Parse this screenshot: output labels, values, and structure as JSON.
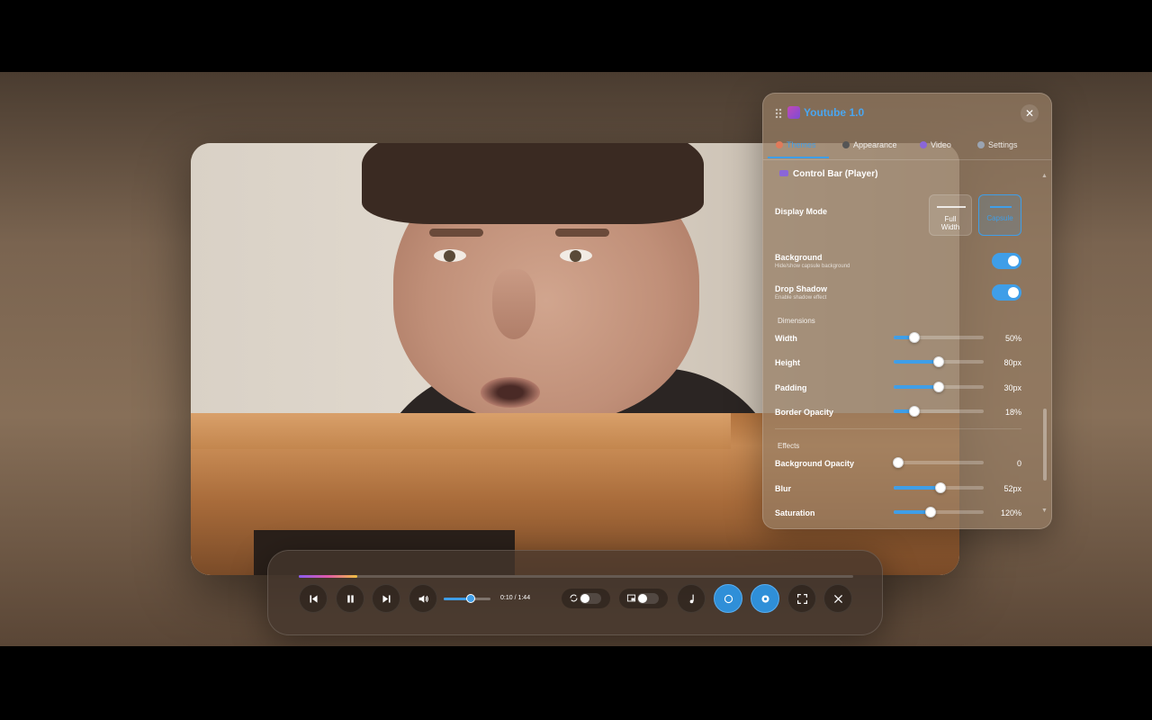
{
  "panel": {
    "title": "Youtube 1.0",
    "close_label": "✕",
    "tabs": [
      {
        "label": "Themes",
        "icon": "palette-icon",
        "active": true
      },
      {
        "label": "Appearance",
        "icon": "circle-half-icon",
        "active": false
      },
      {
        "label": "Video",
        "icon": "gamepad-icon",
        "active": false
      },
      {
        "label": "Settings",
        "icon": "gear-icon",
        "active": false
      }
    ],
    "section_title": "Control Bar (Player)",
    "display_mode": {
      "label": "Display Mode",
      "options": [
        {
          "label_line1": "Full",
          "label_line2": "Width",
          "selected": false
        },
        {
          "label_line1": "Capsule",
          "label_line2": "",
          "selected": true
        }
      ]
    },
    "background": {
      "label": "Background",
      "sub": "Hide/show capsule background",
      "on": true
    },
    "drop_shadow": {
      "label": "Drop Shadow",
      "sub": "Enable shadow effect",
      "on": true
    },
    "dimensions_label": "Dimensions",
    "dimensions": [
      {
        "label": "Width",
        "value": "50%",
        "level": 0.23
      },
      {
        "label": "Height",
        "value": "80px",
        "level": 0.5
      },
      {
        "label": "Padding",
        "value": "30px",
        "level": 0.5
      },
      {
        "label": "Border Opacity",
        "value": "18%",
        "level": 0.23
      }
    ],
    "effects_label": "Effects",
    "effects": [
      {
        "label": "Background Opacity",
        "value": "0",
        "level": 0.05
      },
      {
        "label": "Blur",
        "value": "52px",
        "level": 0.52
      },
      {
        "label": "Saturation",
        "value": "120%",
        "level": 0.41
      }
    ]
  },
  "player": {
    "time": "0:10 / 1:44",
    "progress": 0.105,
    "volume": 0.58
  },
  "colors": {
    "accent": "#3f9ee8",
    "panel_bg": "#967d64",
    "progress_gradient": [
      "#8a5cf0",
      "#e05aa8",
      "#f0c040"
    ]
  }
}
